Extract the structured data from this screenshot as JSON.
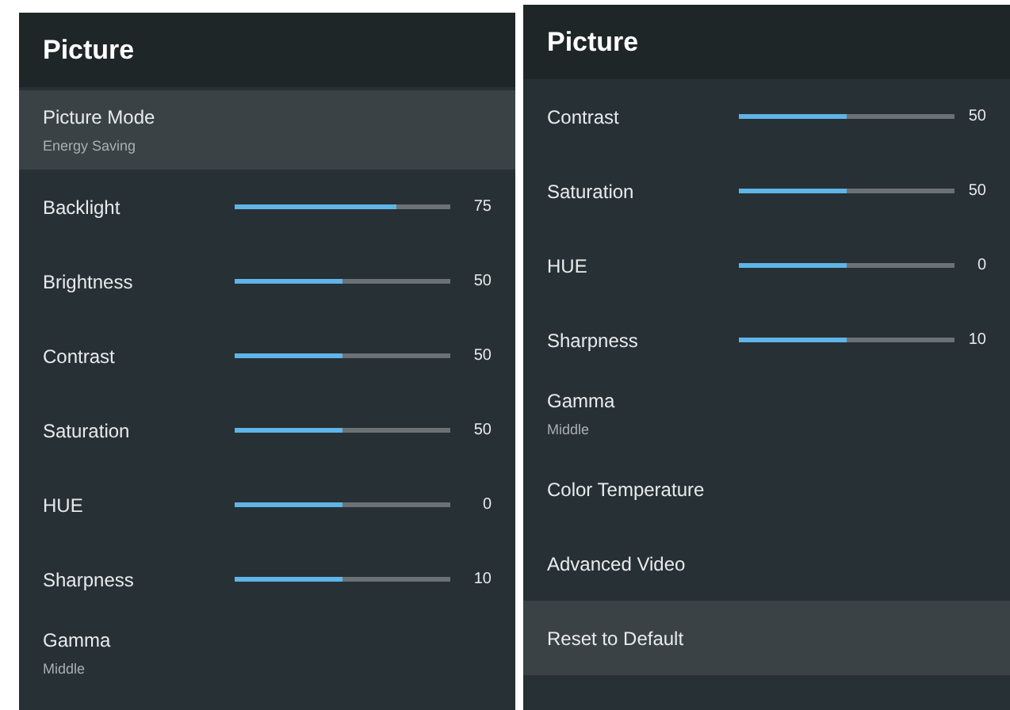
{
  "panels": [
    {
      "title": "Picture",
      "items": [
        {
          "kind": "value",
          "label": "Picture Mode",
          "value": "Energy Saving",
          "selected": true
        },
        {
          "kind": "slider",
          "label": "Backlight",
          "level": 0.75,
          "reading": "75",
          "selected": false
        },
        {
          "kind": "slider",
          "label": "Brightness",
          "level": 0.5,
          "reading": "50",
          "selected": false
        },
        {
          "kind": "slider",
          "label": "Contrast",
          "level": 0.5,
          "reading": "50",
          "selected": false
        },
        {
          "kind": "slider",
          "label": "Saturation",
          "level": 0.5,
          "reading": "50",
          "selected": false
        },
        {
          "kind": "slider",
          "label": "HUE",
          "level": 0.5,
          "reading": "0",
          "selected": false
        },
        {
          "kind": "slider",
          "label": "Sharpness",
          "level": 0.5,
          "reading": "10",
          "selected": false
        },
        {
          "kind": "value",
          "label": "Gamma",
          "value": "Middle",
          "selected": false
        }
      ]
    },
    {
      "title": "Picture",
      "items": [
        {
          "kind": "slider",
          "label": "Contrast",
          "level": 0.5,
          "reading": "50",
          "selected": false
        },
        {
          "kind": "slider",
          "label": "Saturation",
          "level": 0.5,
          "reading": "50",
          "selected": false
        },
        {
          "kind": "slider",
          "label": "HUE",
          "level": 0.5,
          "reading": "0",
          "selected": false
        },
        {
          "kind": "slider",
          "label": "Sharpness",
          "level": 0.5,
          "reading": "10",
          "selected": false
        },
        {
          "kind": "value",
          "label": "Gamma",
          "value": "Middle",
          "selected": false
        },
        {
          "kind": "plain",
          "label": "Color Temperature",
          "selected": false
        },
        {
          "kind": "plain",
          "label": "Advanced Video",
          "selected": false
        },
        {
          "kind": "plain",
          "label": "Reset to Default",
          "selected": true
        }
      ]
    }
  ]
}
